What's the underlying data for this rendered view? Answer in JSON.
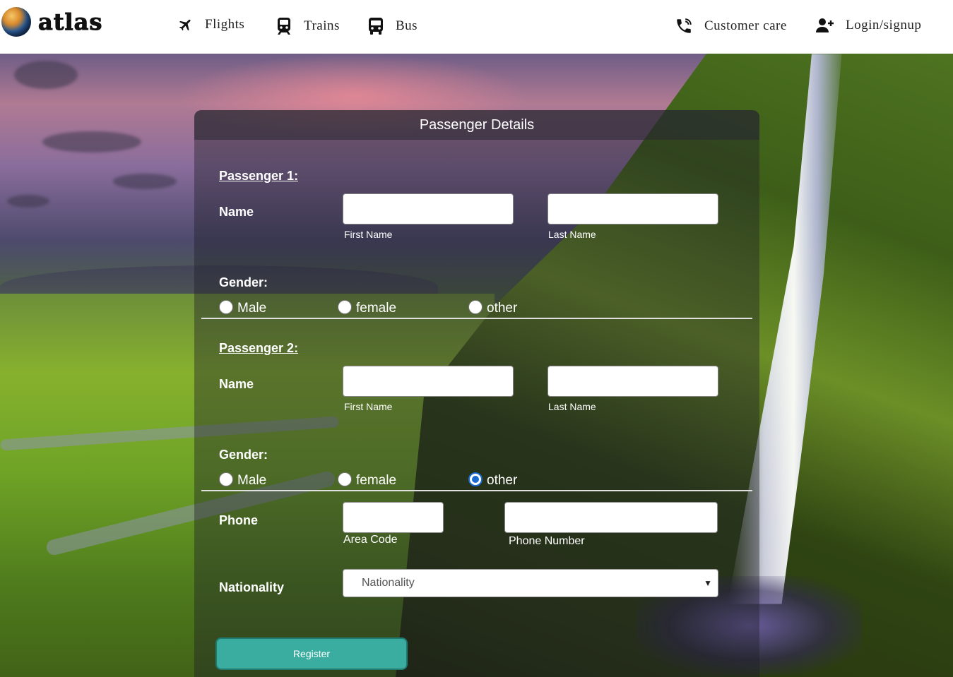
{
  "header": {
    "logo_text": "atlas",
    "nav": [
      {
        "label": "Flights",
        "icon": "airplane-icon"
      },
      {
        "label": "Trains",
        "icon": "train-icon"
      },
      {
        "label": "Bus",
        "icon": "bus-icon"
      }
    ],
    "right_nav": [
      {
        "label": "Customer care",
        "icon": "phone-icon"
      },
      {
        "label": "Login/signup",
        "icon": "user-plus-icon"
      }
    ]
  },
  "form": {
    "title": "Passenger Details",
    "passengers": [
      {
        "heading": "Passenger 1:",
        "name_label": "Name",
        "first_name_value": "",
        "first_name_hint": "First Name",
        "last_name_value": "",
        "last_name_hint": "Last Name",
        "gender_label": "Gender:",
        "gender_options": [
          "Male",
          "female",
          "other"
        ],
        "gender_selected": null
      },
      {
        "heading": "Passenger 2:",
        "name_label": "Name",
        "first_name_value": "",
        "first_name_hint": "First Name",
        "last_name_value": "",
        "last_name_hint": "Last Name",
        "gender_label": "Gender:",
        "gender_options": [
          "Male",
          "female",
          "other"
        ],
        "gender_selected": "other"
      }
    ],
    "phone": {
      "label": "Phone",
      "area_code_value": "",
      "area_code_hint": "Area Code",
      "number_value": "",
      "number_hint": "Phone Number"
    },
    "nationality": {
      "label": "Nationality",
      "selected": "Nationality"
    },
    "submit_label": "Register"
  },
  "colors": {
    "button": "#3aada0",
    "radio_selected": "#1a6bd1"
  }
}
